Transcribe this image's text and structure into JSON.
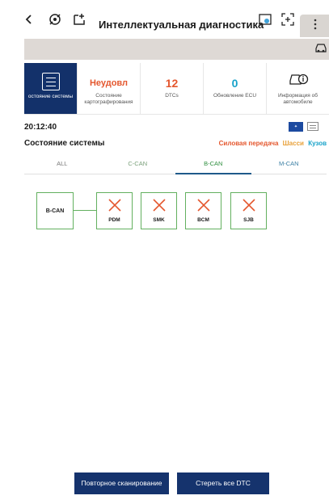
{
  "header": {
    "title": "Интеллектуальная диагностика",
    "back_icon": "chevron-left-icon",
    "menu_icon": "more-vertical-icon"
  },
  "tiles": [
    {
      "big": "",
      "label": "остояние системы",
      "icon": "system-status-icon",
      "active": true
    },
    {
      "big": "Неудовл",
      "label": "Состояние картографирования",
      "color": "#e4572e"
    },
    {
      "big": "12",
      "label": "DTCs",
      "color": "#e4572e"
    },
    {
      "big": "0",
      "label": "Обновление ECU",
      "color": "#17a2c9"
    },
    {
      "big": "",
      "label": "Информация об автомобиле",
      "icon": "vehicle-info-icon"
    }
  ],
  "time": "20:12:40",
  "system_label": "Состояние системы",
  "filters": [
    {
      "label": "Силовая передача",
      "color": "#e4572e"
    },
    {
      "label": "Шасси",
      "color": "#e8a13a"
    },
    {
      "label": "Кузов",
      "color": "#17a2c9"
    }
  ],
  "tabs": [
    {
      "label": "ALL"
    },
    {
      "label": "C-CAN"
    },
    {
      "label": "B-CAN",
      "active": true
    },
    {
      "label": "M-CAN"
    }
  ],
  "topology": {
    "bus": "B-CAN",
    "ecus": [
      "PDM",
      "SMK",
      "BCM",
      "SJB"
    ],
    "ecu_status": "fault"
  },
  "buttons": {
    "rescan": "Повторное сканирование",
    "clear_dtc": "Стереть все DTC"
  },
  "colors": {
    "accent": "#15336d",
    "fault": "#e4572e",
    "link": "#63b05f"
  }
}
